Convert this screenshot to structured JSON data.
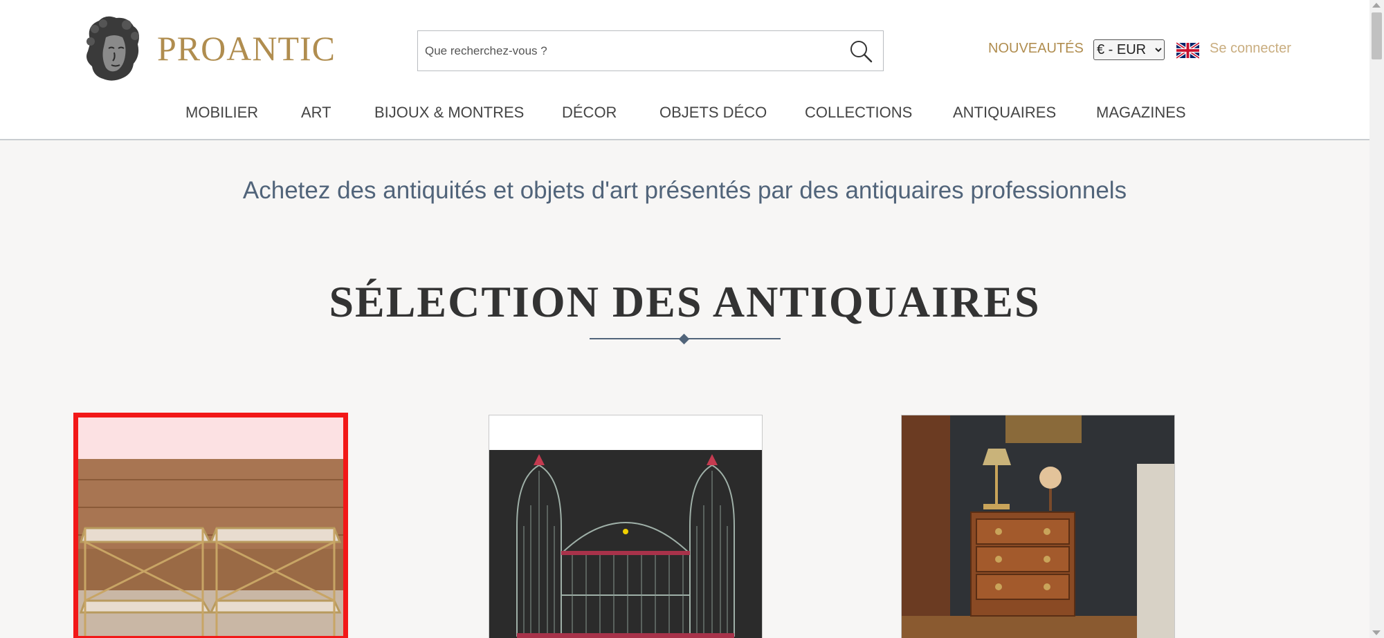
{
  "header": {
    "brand": "PROANTIC",
    "search_placeholder": "Que recherchez-vous ?",
    "nouveautes": "NOUVEAUTÉS",
    "currency": "€ - EUR",
    "currency_options": [
      "€ - EUR"
    ],
    "login": "Se connecter"
  },
  "nav": [
    {
      "label": "MOBILIER"
    },
    {
      "label": "ART"
    },
    {
      "label": "BIJOUX & MONTRES"
    },
    {
      "label": "DÉCOR"
    },
    {
      "label": "OBJETS DÉCO"
    },
    {
      "label": "COLLECTIONS"
    },
    {
      "label": "ANTIQUAIRES"
    },
    {
      "label": "MAGAZINES"
    }
  ],
  "hero": {
    "tagline": "Achetez des antiquités et objets d'art présentés par des antiquaires professionnels"
  },
  "section": {
    "title": "SÉLECTION DES ANTIQUAIRES"
  },
  "colors": {
    "gold": "#b08d4f",
    "slate": "#51647a",
    "highlight": "#f21818"
  },
  "products": [
    {
      "icon": "side-tables-image"
    },
    {
      "icon": "birdcage-image"
    },
    {
      "icon": "chest-of-drawers-image"
    }
  ]
}
